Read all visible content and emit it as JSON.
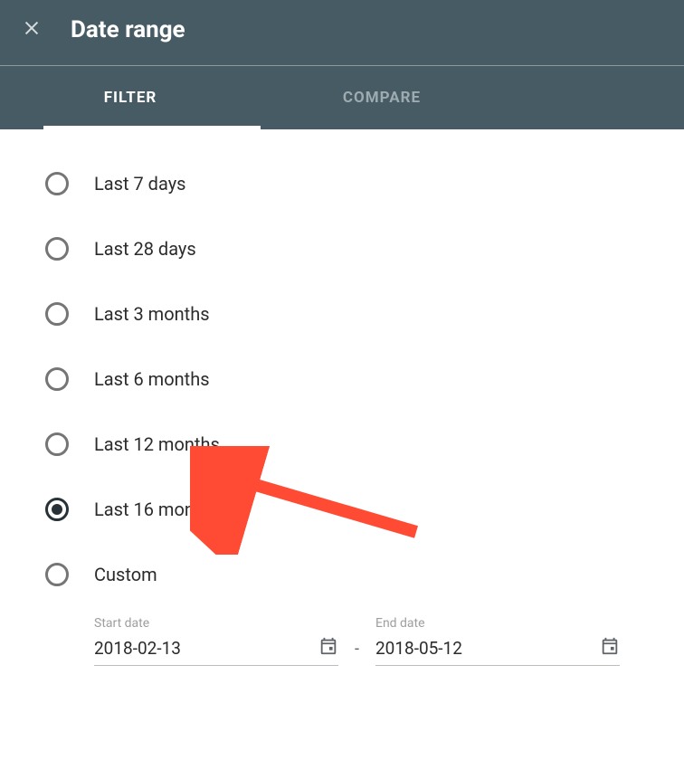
{
  "header": {
    "title": "Date range",
    "close_icon": "close"
  },
  "tabs": {
    "filter": "Filter",
    "compare": "Compare",
    "active": "filter"
  },
  "options": [
    {
      "label": "Last 7 days",
      "selected": false
    },
    {
      "label": "Last 28 days",
      "selected": false
    },
    {
      "label": "Last 3 months",
      "selected": false
    },
    {
      "label": "Last 6 months",
      "selected": false
    },
    {
      "label": "Last 12 months",
      "selected": false
    },
    {
      "label": "Last 16 months",
      "selected": true
    },
    {
      "label": "Custom",
      "selected": false
    }
  ],
  "date_fields": {
    "start_label": "Start date",
    "start_value": "2018-02-13",
    "separator": "-",
    "end_label": "End date",
    "end_value": "2018-05-12"
  },
  "annotation": {
    "type": "arrow",
    "color": "#ff4b33",
    "points_to": "Last 16 months"
  }
}
